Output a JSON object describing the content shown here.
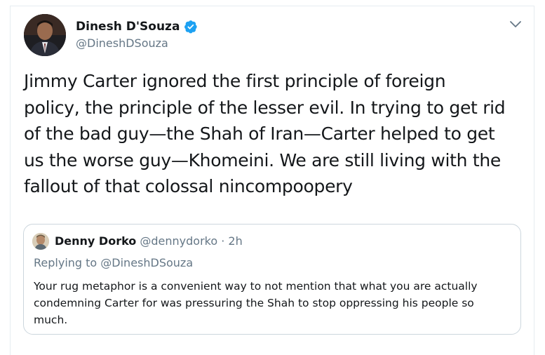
{
  "tweet": {
    "author_name": "Dinesh D'Souza",
    "author_handle": "@DineshDSouza",
    "verified_icon": "verified-badge-icon",
    "menu_icon": "chevron-down-icon",
    "text_lines": [
      "Jimmy Carter ignored the first principle of foreign",
      "policy, the principle of the lesser evil. In trying to get rid",
      "of the bad guy—the Shah of Iran—Carter helped to get",
      "us the worse guy—Khomeini. We are still living with the",
      "fallout of that colossal nincompoopery"
    ]
  },
  "quoted": {
    "author_name": "Denny Dorko",
    "author_handle": "@dennydorko",
    "separator": "·",
    "time": "2h",
    "replying_to": "Replying to @DineshDSouza",
    "text_lines": [
      "Your rug metaphor is a convenient way to not mention that what you are actually",
      "condemning Carter for was pressuring the Shah to stop oppressing his people so",
      "much."
    ]
  },
  "colors": {
    "primary_text": "#14171a",
    "secondary_text": "#657786",
    "verified_blue": "#1da1f2",
    "border": "#ccd6dd"
  }
}
